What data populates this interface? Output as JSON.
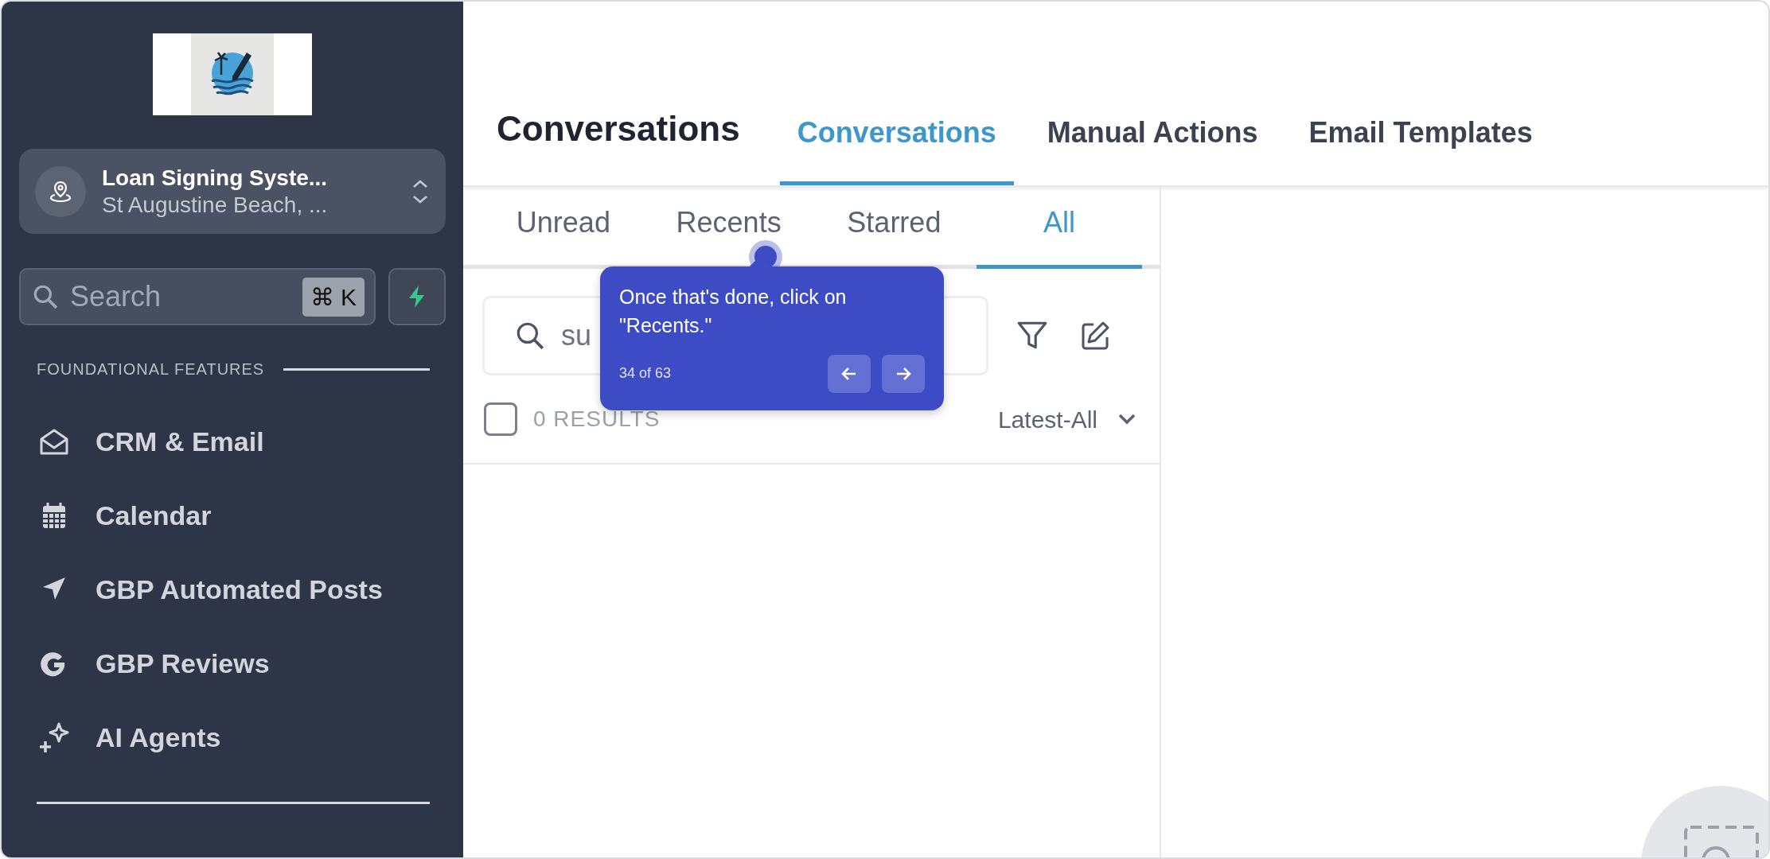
{
  "sidebar": {
    "location": {
      "name": "Loan Signing Syste...",
      "address": "St Augustine Beach, ..."
    },
    "search": {
      "placeholder": "Search",
      "shortcut": "⌘ K"
    },
    "section_label": "FOUNDATIONAL FEATURES",
    "items": [
      {
        "label": "CRM & Email",
        "kind": "envelope"
      },
      {
        "label": "Calendar",
        "kind": "calendar"
      },
      {
        "label": "GBP Automated Posts",
        "kind": "navigation"
      },
      {
        "label": "GBP Reviews",
        "kind": "google"
      },
      {
        "label": "AI Agents",
        "kind": "sparkles"
      }
    ]
  },
  "header": {
    "title": "Conversations",
    "tabs": [
      {
        "label": "Conversations",
        "selected": true
      },
      {
        "label": "Manual Actions",
        "selected": false
      },
      {
        "label": "Email Templates",
        "selected": false
      }
    ]
  },
  "inbox": {
    "tabs": [
      {
        "label": "Unread",
        "selected": false
      },
      {
        "label": "Recents",
        "selected": false
      },
      {
        "label": "Starred",
        "selected": false
      },
      {
        "label": "All",
        "selected": true
      }
    ],
    "search": {
      "placeholder": "su"
    },
    "select_all_checked": false,
    "results": "0 RESULTS",
    "sort": "Latest-All"
  },
  "tour_tooltip": {
    "text": "Once that's done, click on \"Recents.\"",
    "progress": "34 of 63"
  }
}
